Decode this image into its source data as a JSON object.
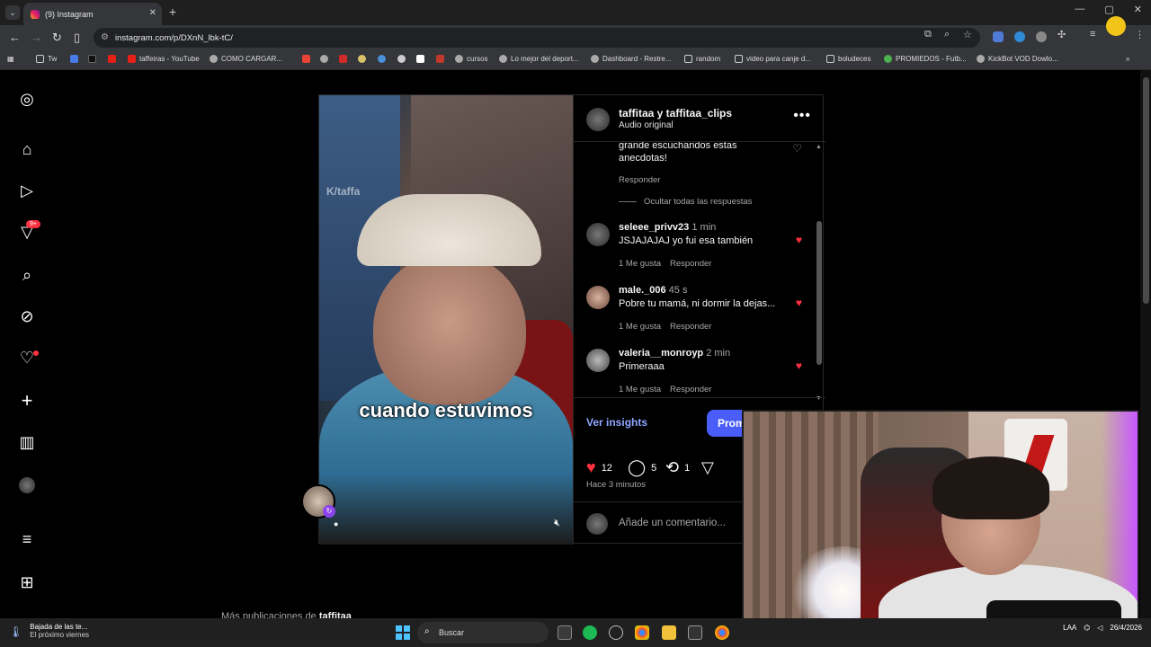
{
  "browser": {
    "tab_title": "(9) Instagram",
    "url": "instagram.com/p/DXnN_lbk-tC/",
    "bookmarks": [
      "Tw",
      "taffeiras - YouTube",
      "COMO CARGAR...",
      "cursos",
      "Lo mejor del deport...",
      "Dashboard - Restre...",
      "random",
      "video para canje d...",
      "boludeces",
      "PROMIEDOS - Futb...",
      "KickBot VOD Dowlo..."
    ]
  },
  "sidenav": {
    "notif_badge": "9+"
  },
  "post": {
    "video": {
      "watermark": "K/taffa",
      "subtitle": "cuando estuvimos"
    },
    "header": {
      "authors": "taffitaa y taffitaa_clips",
      "audio": "Audio original",
      "more": "•••"
    },
    "partial_comment": {
      "text_line1": "grande escuchandos estas",
      "text_line2": "anecdotas!",
      "reply": "Responder"
    },
    "hide_replies": "Ocultar todas las respuestas",
    "comments": [
      {
        "user": "seleee_privv23",
        "time": "1 min",
        "text": "JSJAJAJAJ yo fui esa también",
        "likes": "1 Me gusta",
        "reply": "Responder"
      },
      {
        "user": "male._006",
        "time": "45 s",
        "text": "Pobre tu mamá, ni dormir la dejas...",
        "likes": "1 Me gusta",
        "reply": "Responder"
      },
      {
        "user": "valeria__monroyp",
        "time": "2 min",
        "text": "Primeraaa",
        "likes": "1 Me gusta",
        "reply": "Responder"
      }
    ],
    "insights": "Ver insights",
    "promote": "Prom",
    "counts": {
      "likes": "12",
      "comments": "5",
      "reposts": "1"
    },
    "time_ago": "Hace 3 minutos",
    "comment_placeholder": "Añade un comentario..."
  },
  "more_publications": {
    "prefix": "Más publicaciones de",
    "user": "taffitaa"
  },
  "taskbar": {
    "weather_title": "Bajada de las te...",
    "weather_sub": "El próximo viernes",
    "search": "Buscar",
    "lang": "LAA",
    "date": "26/4/2026"
  }
}
